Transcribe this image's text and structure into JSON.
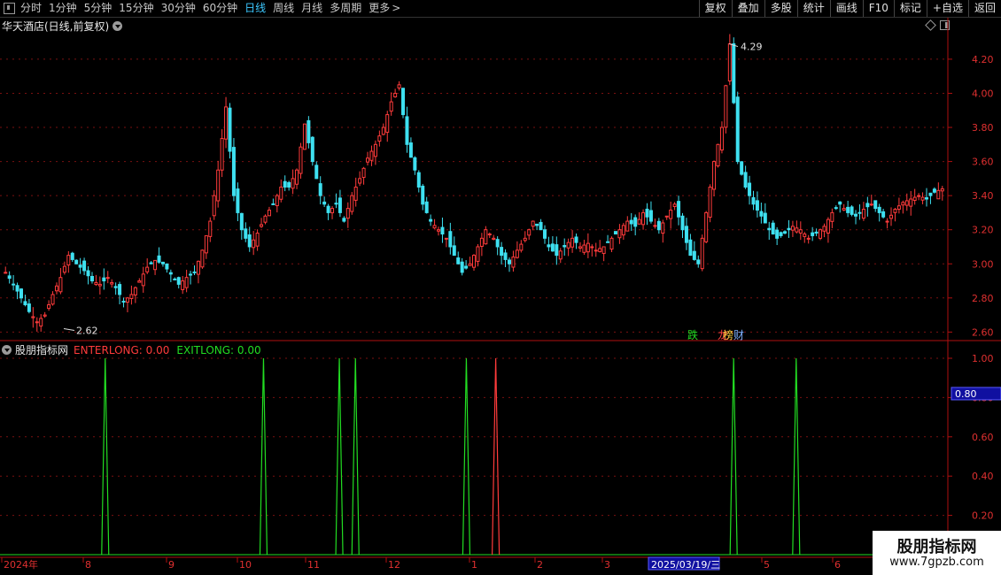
{
  "toolbar": {
    "periods": [
      "分时",
      "1分钟",
      "5分钟",
      "15分钟",
      "30分钟",
      "60分钟",
      "日线",
      "周线",
      "月线",
      "多周期",
      "更多"
    ],
    "active_period": "日线",
    "right_buttons": [
      "复权",
      "叠加",
      "多股",
      "统计",
      "画线",
      "F10",
      "标记",
      "+自选",
      "返回"
    ]
  },
  "main_chart": {
    "title": "华天酒店(日线,前复权)",
    "y_ticks": [
      "4.20",
      "4.00",
      "3.80",
      "3.60",
      "3.40",
      "3.20",
      "3.00",
      "2.80",
      "2.60"
    ],
    "high_label": "4.29",
    "low_label": "2.62",
    "tags": [
      {
        "text": "跌",
        "color": "#22dd22"
      },
      {
        "text": "龙",
        "color": "#ff4040"
      },
      {
        "text": "榜",
        "color": "#ffd040"
      },
      {
        "text": "财",
        "color": "#7fb0ff"
      }
    ]
  },
  "indicator": {
    "name": "股朋指标网",
    "enter_label": "ENTERLONG: 0.00",
    "exit_label": "EXITLONG: 0.00",
    "y_ticks": [
      "1.00",
      "0.80",
      "0.60",
      "0.40",
      "0.20"
    ],
    "cursor_value": "0.80"
  },
  "x_axis": {
    "labels": [
      "2024年",
      "8",
      "9",
      "10",
      "11",
      "12",
      "1",
      "2",
      "3",
      "2025/03/19/三",
      "5",
      "6"
    ]
  },
  "colors": {
    "up": "#ff3b3b",
    "down": "#3ee0f0",
    "grid": "#7a1010",
    "signal_green": "#22dd22",
    "signal_red": "#ff3b3b"
  },
  "chart_data": {
    "type": "candlestick",
    "title": "华天酒店(日线,前复权)",
    "y_range": [
      2.55,
      4.35
    ],
    "series_close_approx": [
      {
        "month": "2024-07",
        "values": [
          2.95,
          2.88,
          2.8,
          2.72,
          2.66,
          2.7,
          2.82,
          2.92,
          3.05,
          3.0,
          2.96,
          2.9
        ]
      },
      {
        "month": "2024-08",
        "values": [
          2.88,
          2.92,
          2.86,
          2.78,
          2.82,
          2.9,
          2.98,
          3.02,
          3.0,
          2.94,
          2.88,
          2.92
        ]
      },
      {
        "month": "2024-09",
        "values": [
          2.95,
          3.08,
          3.25,
          3.55,
          3.92,
          3.4,
          3.2,
          3.1,
          3.18,
          3.28,
          3.35,
          3.45
        ]
      },
      {
        "month": "2024-10",
        "values": [
          3.45,
          3.55,
          3.82,
          3.6,
          3.4,
          3.3,
          3.35,
          3.25,
          3.4,
          3.5,
          3.62,
          3.7
        ]
      },
      {
        "month": "2024-11",
        "values": [
          3.8,
          3.95,
          4.05,
          3.7,
          3.55,
          3.35,
          3.25,
          3.2,
          3.15,
          3.05,
          2.95,
          3.0
        ]
      },
      {
        "month": "2024-12",
        "values": [
          3.1,
          3.2,
          3.15,
          3.05,
          3.0,
          3.08,
          3.15,
          3.25,
          3.2,
          3.1,
          3.05,
          3.1
        ]
      },
      {
        "month": "2025-01",
        "values": [
          3.15,
          3.1,
          3.12,
          3.08,
          3.1,
          3.15,
          3.2,
          3.25,
          3.22,
          3.3,
          3.25,
          3.2
        ]
      },
      {
        "month": "2025-02",
        "values": [
          3.28,
          3.35,
          3.2,
          3.05,
          3.0,
          3.3,
          3.6,
          3.8,
          4.29,
          3.6,
          3.45,
          3.35
        ]
      },
      {
        "month": "2025-03",
        "values": [
          3.28,
          3.2,
          3.15,
          3.18,
          3.22,
          3.2,
          3.15,
          3.18,
          3.22,
          3.3,
          3.35,
          3.3
        ]
      },
      {
        "month": "2025-04",
        "values": [
          3.28,
          3.32,
          3.35,
          3.3,
          3.25,
          3.32,
          3.36,
          3.38,
          3.4,
          3.38,
          3.42,
          3.44
        ]
      }
    ],
    "signals": [
      {
        "type": "EXITLONG",
        "x_frac": 0.111
      },
      {
        "type": "EXITLONG",
        "x_frac": 0.278
      },
      {
        "type": "EXITLONG",
        "x_frac": 0.358
      },
      {
        "type": "EXITLONG",
        "x_frac": 0.375
      },
      {
        "type": "EXITLONG",
        "x_frac": 0.492
      },
      {
        "type": "ENTERLONG",
        "x_frac": 0.523
      },
      {
        "type": "EXITLONG",
        "x_frac": 0.774
      },
      {
        "type": "EXITLONG",
        "x_frac": 0.84
      }
    ]
  }
}
